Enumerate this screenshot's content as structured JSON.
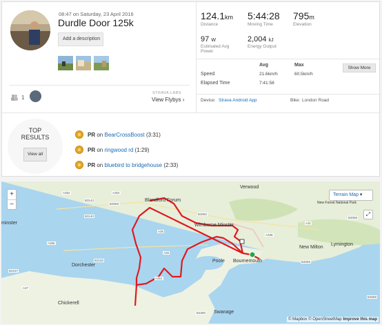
{
  "activity": {
    "date": "08:47 on Saturday, 23 April 2016",
    "title": "Durdle Door 125k",
    "add_description": "Add a description"
  },
  "kudos": {
    "count": "1"
  },
  "flyby": {
    "labs": "STRAVA LABS",
    "label": "View Flybys"
  },
  "stats": {
    "distance": {
      "value": "124.1",
      "unit": "km",
      "label": "Distance"
    },
    "moving_time": {
      "value": "5:44:28",
      "label": "Moving Time"
    },
    "elevation": {
      "value": "795",
      "unit": "m",
      "label": "Elevation"
    },
    "power": {
      "value": "97",
      "unit": "W",
      "label": "Estimated Avg Power"
    },
    "energy": {
      "value": "2,004",
      "unit": "kJ",
      "label": "Energy Output"
    }
  },
  "speed_table": {
    "col_avg": "Avg",
    "col_max": "Max",
    "speed_label": "Speed",
    "speed_avg": "21.6km/h",
    "speed_max": "60.5km/h",
    "elapsed_label": "Elapsed Time",
    "elapsed_value": "7:41:58",
    "show_more": "Show More"
  },
  "device": {
    "device_label": "Device:",
    "device_value": "Strava Android App",
    "bike_label": "Bike:",
    "bike_value": "London Road"
  },
  "results": {
    "title": "TOP RESULTS",
    "view_all": "View all",
    "items": [
      {
        "pr": "PR",
        "on": "on",
        "segment": "BearCrossBoost",
        "time": "(3:31)"
      },
      {
        "pr": "PR",
        "on": "on",
        "segment": "ringwood rd",
        "time": "(1:29)"
      },
      {
        "pr": "PR",
        "on": "on",
        "segment": "bluebird to bridgehouse",
        "time": "(2:33)"
      }
    ]
  },
  "map": {
    "zoom_in": "+",
    "zoom_out": "−",
    "terrain_label": "Terrain Map",
    "attribution_mapbox": "© Mapbox",
    "attribution_osm": "© OpenStreetMap",
    "attribution_improve": "Improve this map",
    "places": {
      "verwood": "Verwood",
      "blandford": "Blandford Forum",
      "wimborne": "Wimborne Minster",
      "poole": "Poole",
      "bournemouth": "Bournemouth",
      "dorchester": "Dorchester",
      "swanage": "Swanage",
      "chickerell": "Chickerell",
      "new_milton": "New Milton",
      "lymington": "Lymington",
      "national_park": "New Forest National Park",
      "minster": "minster"
    },
    "roads": [
      "A352",
      "B3143",
      "B3140",
      "A356",
      "A35",
      "B3157",
      "B3082",
      "A338",
      "A31",
      "B3058",
      "A37",
      "B3150",
      "B3390",
      "A351",
      "B3069",
      "B3055",
      "A35",
      "B3059",
      "A352"
    ],
    "colors": {
      "route": "#e0191f",
      "start": "#22a84a",
      "land": "#e8eedb",
      "water": "#a9d5ef"
    }
  }
}
